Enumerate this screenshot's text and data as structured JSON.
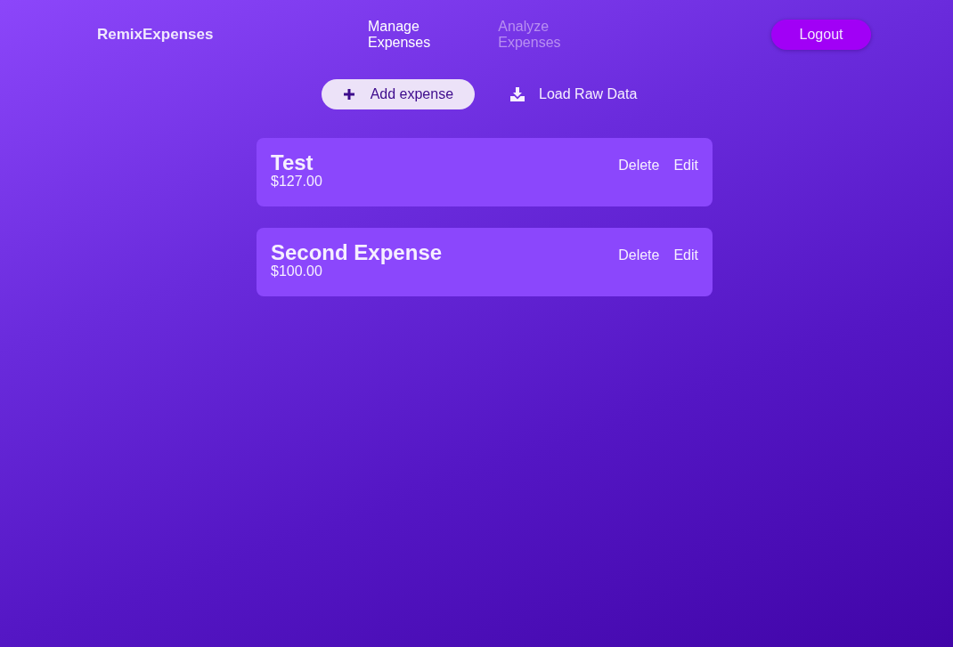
{
  "header": {
    "brand": "RemixExpenses",
    "nav": [
      {
        "label": "Manage Expenses",
        "selected": true
      },
      {
        "label": "Analyze Expenses",
        "selected": false
      }
    ],
    "logout": "Logout"
  },
  "actions": [
    {
      "kind": "add",
      "label": "Add expense"
    },
    {
      "kind": "download",
      "label": "Load Raw Data"
    }
  ],
  "expenses": [
    {
      "title": "Test",
      "amount": "$127.00",
      "actions": [
        "Delete",
        "Edit"
      ]
    },
    {
      "title": "Second Expense",
      "amount": "$100.00",
      "actions": [
        "Delete",
        "Edit"
      ]
    }
  ]
}
